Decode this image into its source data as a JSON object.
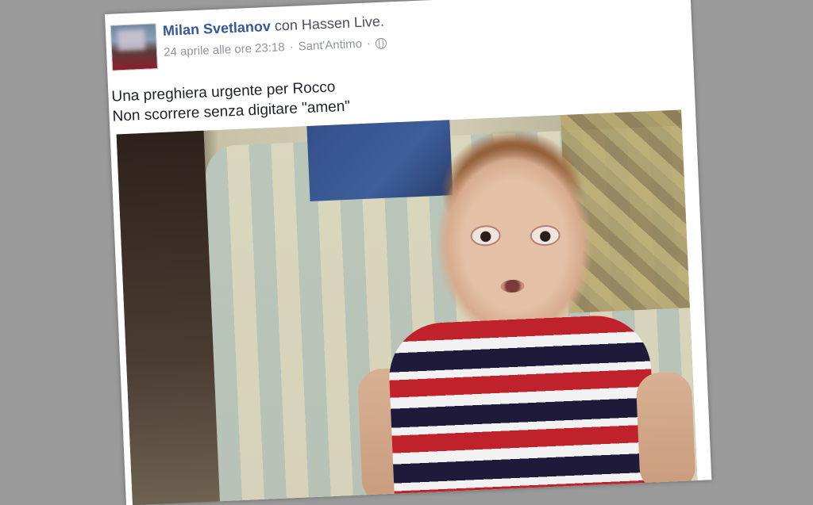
{
  "post": {
    "author": "Milan Svetlanov",
    "with_text": "con",
    "tagged": "Hassen Live.",
    "date": "24 aprile alle ore 23:18",
    "separator": "·",
    "location": "Sant'Antimo",
    "separator2": "·",
    "privacy_icon": "globe-icon",
    "text_line1": "Una preghiera urgente per Rocco",
    "text_line2": "Non scorrere senza digitare \"amen\""
  },
  "colors": {
    "background": "#9a9a9a",
    "card": "#ffffff",
    "author_link": "#365899",
    "meta": "#90949c"
  }
}
